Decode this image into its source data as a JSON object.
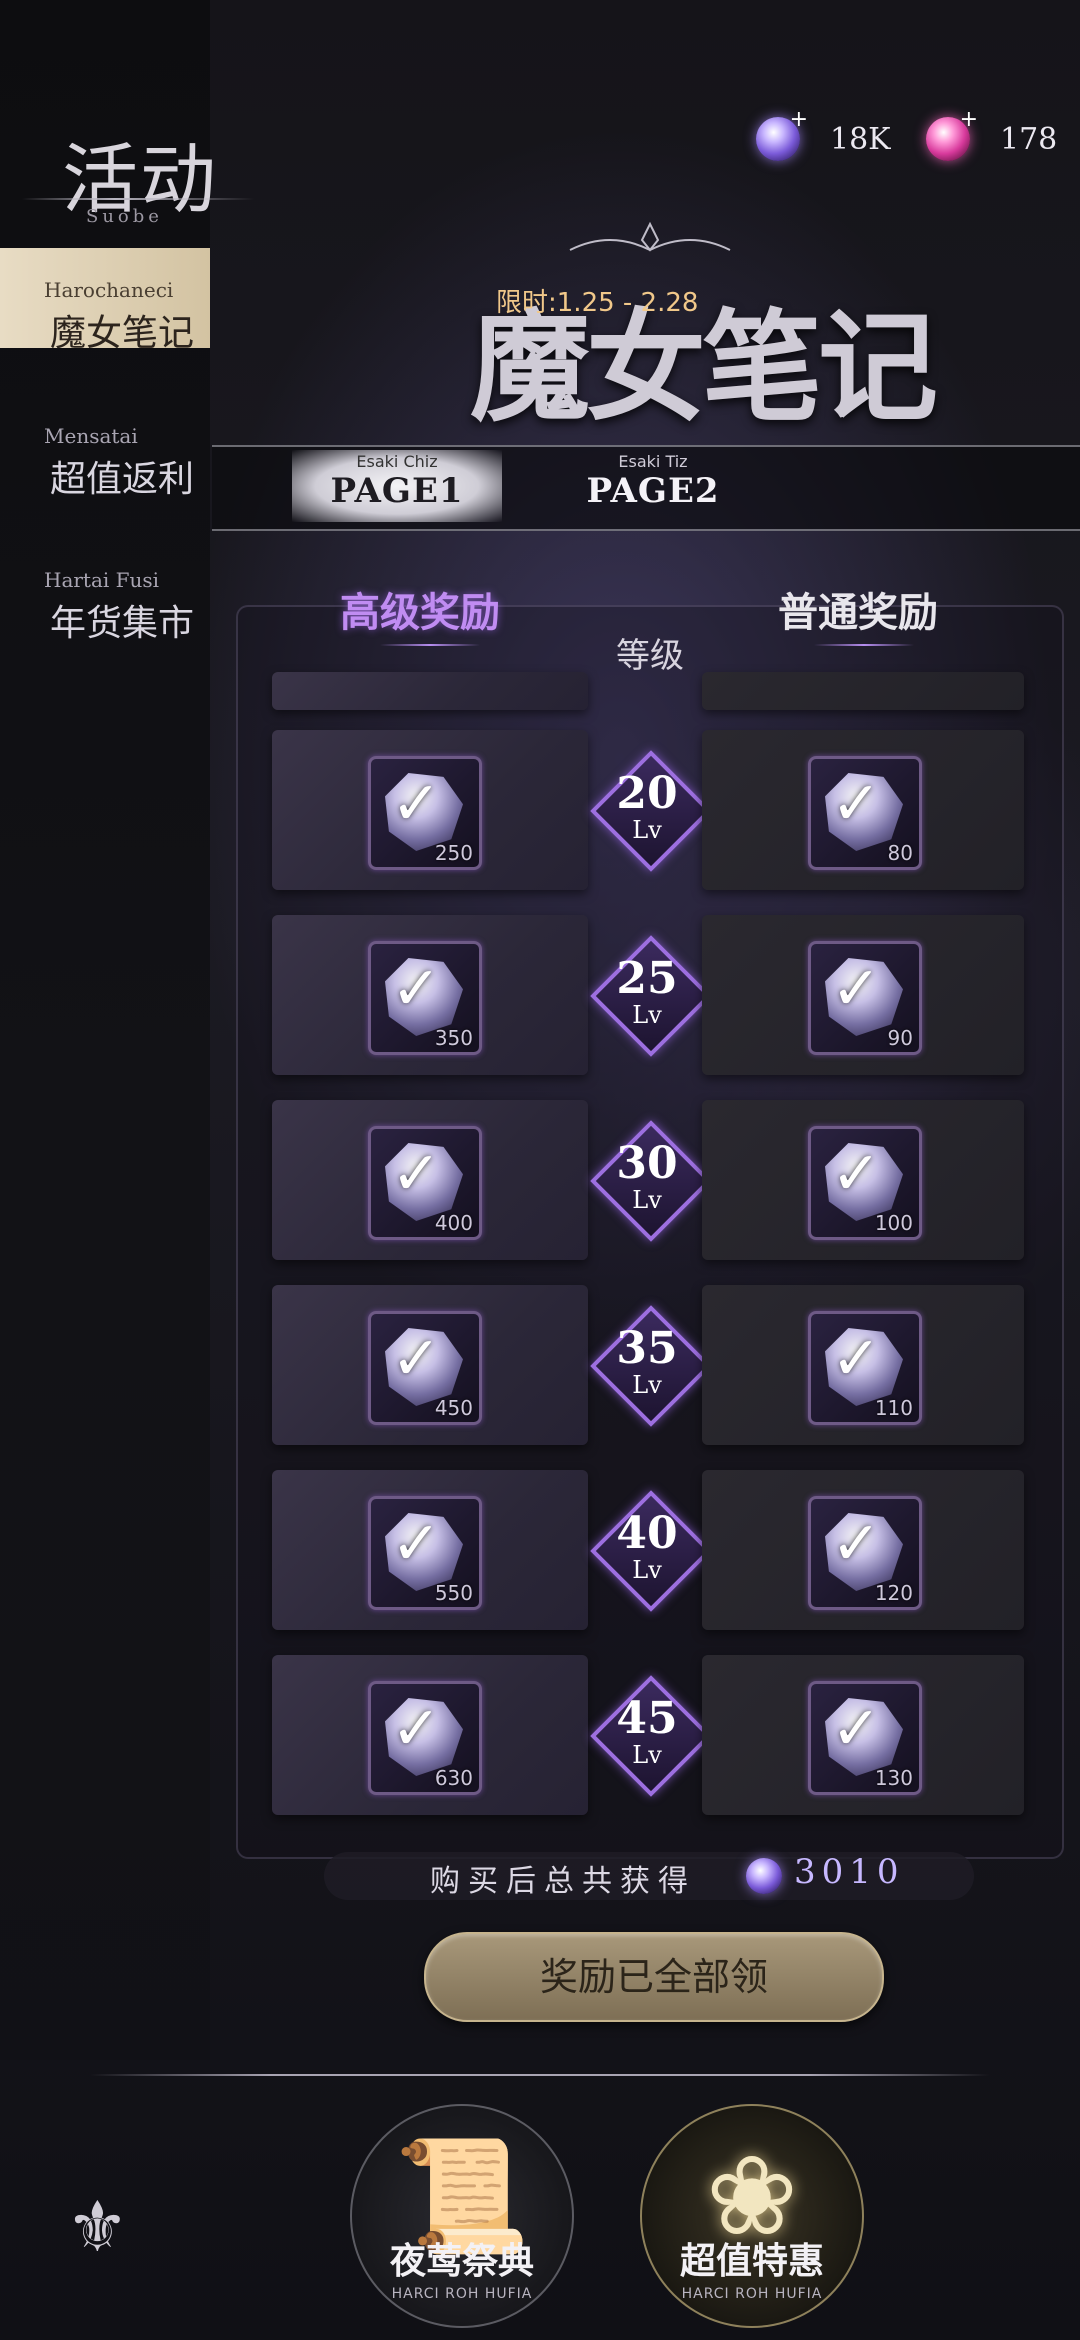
{
  "sidebar": {
    "title": "活动",
    "subtitle": "Suobe",
    "items": [
      {
        "en": "Harochaneci",
        "zh": "魔女笔记",
        "active": true
      },
      {
        "en": "Mensatai",
        "zh": "超值返利",
        "active": false
      },
      {
        "en": "Hartai Fusi",
        "zh": "年货集市",
        "active": false
      }
    ]
  },
  "currency": [
    {
      "icon": "purple-gem-icon",
      "value": "18K"
    },
    {
      "icon": "pink-gem-icon",
      "value": "178"
    }
  ],
  "banner": {
    "title": "魔女笔记",
    "time_limit": "限时:1.25 - 2.28"
  },
  "tabs": [
    {
      "en": "Esaki Chiz",
      "label": "PAGE1",
      "active": true
    },
    {
      "en": "Esaki Tiz",
      "label": "PAGE2",
      "active": false
    }
  ],
  "rewards": {
    "premium_header": "高级奖励",
    "normal_header": "普通奖励",
    "level_header": "等级",
    "level_suffix": "Lv",
    "rows": [
      {
        "level": "20",
        "premium": "250",
        "normal": "80"
      },
      {
        "level": "25",
        "premium": "350",
        "normal": "90"
      },
      {
        "level": "30",
        "premium": "400",
        "normal": "100"
      },
      {
        "level": "35",
        "premium": "450",
        "normal": "110"
      },
      {
        "level": "40",
        "premium": "550",
        "normal": "120"
      },
      {
        "level": "45",
        "premium": "630",
        "normal": "130"
      }
    ]
  },
  "total": {
    "label": "购买后总共获得",
    "value": "3010"
  },
  "claim_button": "奖励已全部领",
  "bottom_nav": [
    {
      "label": "夜莺祭典",
      "sub": "HARCI ROH HUFIA",
      "icon": "scroll-icon"
    },
    {
      "label": "超值特惠",
      "sub": "HARCI ROH HUFIA",
      "icon": "rose-icon"
    }
  ],
  "colors": {
    "premium": "#c08cf2",
    "accent_gold": "#f1c88a"
  }
}
